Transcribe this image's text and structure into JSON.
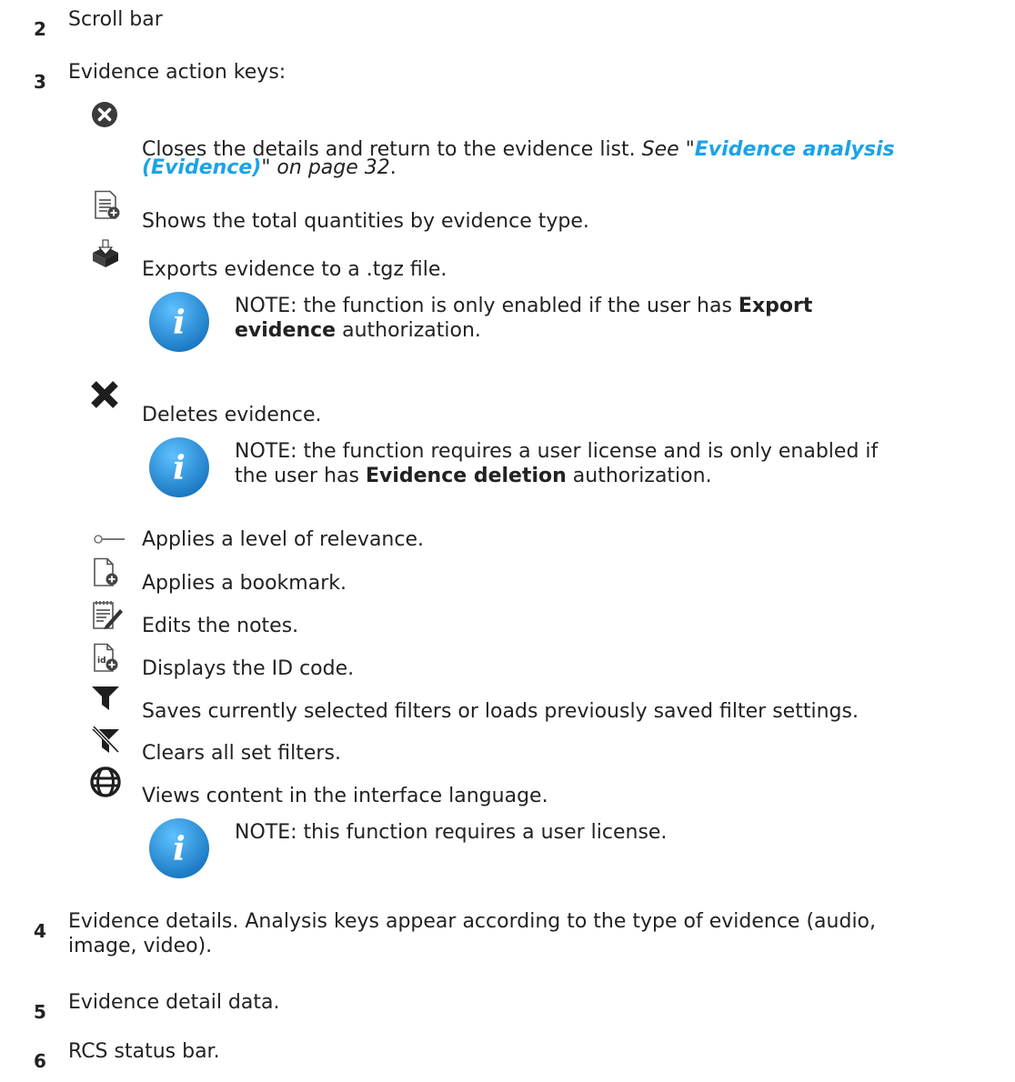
{
  "items": [
    {
      "num": "2",
      "text": "Scroll bar"
    },
    {
      "num": "3",
      "text": "Evidence action keys:"
    },
    {
      "num": "4",
      "text": "Evidence details. Analysis keys appear according to the type of evidence (audio,",
      "text2": "image, video)."
    },
    {
      "num": "5",
      "text": "Evidence detail data."
    },
    {
      "num": "6",
      "text": "RCS status bar."
    }
  ],
  "keys": {
    "close": {
      "icon": "close-circle-icon",
      "text": "Closes the details and return to the evidence list. ",
      "see": "See \"",
      "link1": "Evidence analysis",
      "link2": "(Evidence)",
      "after": "\" on page 32",
      "period": "."
    },
    "totals": {
      "icon": "list-add-icon",
      "text": "Shows the total quantities by evidence type."
    },
    "export": {
      "icon": "download-box-icon",
      "text": "Exports evidence to a .tgz file."
    },
    "delete": {
      "icon": "x-icon",
      "text": "Deletes evidence."
    },
    "relevance": {
      "icon": "slider-icon",
      "text": "Applies a level of relevance."
    },
    "bookmark": {
      "icon": "bookmark-add-icon",
      "text": "Applies a bookmark."
    },
    "notes": {
      "icon": "edit-notes-icon",
      "text": "Edits the notes."
    },
    "idcode": {
      "icon": "id-add-icon",
      "text": "Displays the ID code."
    },
    "savefilters": {
      "icon": "filter-save-icon",
      "text": "Saves currently selected filters or loads previously saved filter settings."
    },
    "clearfilters": {
      "icon": "filter-clear-icon",
      "text": "Clears all set filters."
    },
    "language": {
      "icon": "globe-icon",
      "text": "Views content in the interface language."
    }
  },
  "notes": {
    "export": {
      "pre": "NOTE: the function is only enabled if the user has ",
      "bold1": "Export",
      "bold2": "evidence",
      "post": " authorization."
    },
    "delete": {
      "pre": "NOTE: the function requires a user license and is only enabled if",
      "pre2": "the user has ",
      "bold": "Evidence deletion",
      "post": " authorization."
    },
    "language": {
      "text": "NOTE: this function requires a user license."
    }
  },
  "colors": {
    "link": "#1aa3e8",
    "info_blue": "#1f8fd6",
    "icon_dark": "#333333"
  }
}
